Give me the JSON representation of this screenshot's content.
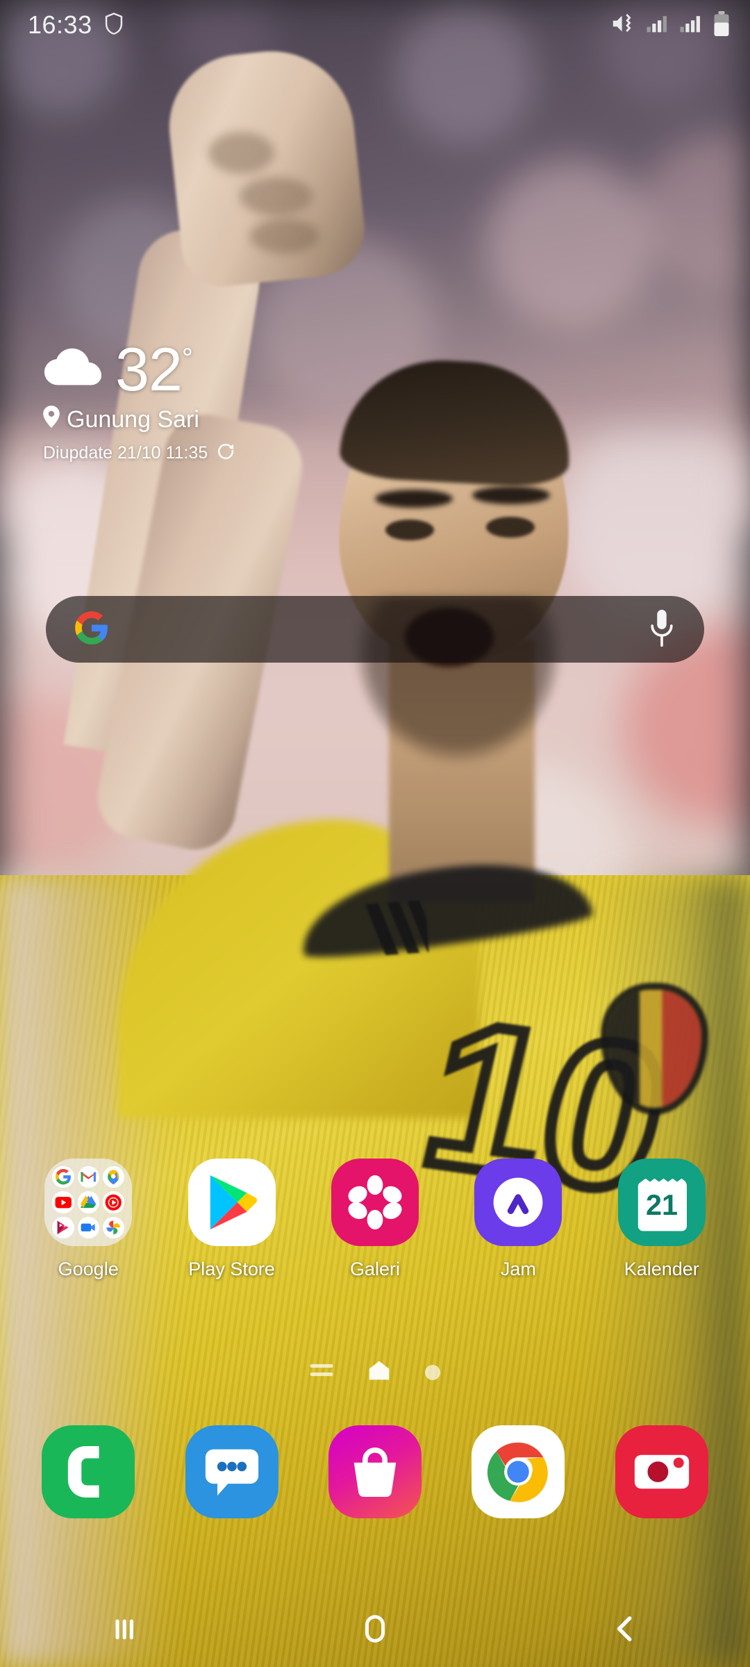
{
  "status_bar": {
    "time": "16:33",
    "icons": [
      "shield-icon",
      "sound-mute-vibrate-icon",
      "signal-sim1-icon",
      "signal-sim2-icon",
      "battery-icon"
    ],
    "battery_level_percent": 60
  },
  "weather_widget": {
    "condition_icon": "cloud-icon",
    "temperature": "32",
    "degree_symbol": "°",
    "location": "Gunung Sari",
    "location_icon": "location-pin-icon",
    "updated_text": "Diupdate 21/10 11:35",
    "refresh_icon": "refresh-icon"
  },
  "search_bar": {
    "leading_icon": "google-g-icon",
    "trailing_icon": "microphone-icon",
    "query": ""
  },
  "app_grid": [
    {
      "label": "Google",
      "type": "folder",
      "bg": "#f0f0f0",
      "apps": [
        "google-icon",
        "gmail-icon",
        "maps-icon",
        "youtube-icon",
        "drive-icon",
        "youtube-music-icon",
        "play-movies-icon",
        "meet-icon",
        "photos-icon"
      ]
    },
    {
      "label": "Play Store",
      "type": "app",
      "icon": "play-store-icon",
      "bg": "#ffffff"
    },
    {
      "label": "Galeri",
      "type": "app",
      "icon": "gallery-flower-icon",
      "bg": "#e3146a"
    },
    {
      "label": "Jam",
      "type": "app",
      "icon": "clock-icon",
      "bg": "#6b3ce9"
    },
    {
      "label": "Kalender",
      "type": "app",
      "icon": "calendar-icon",
      "bg": "#12a182",
      "date": "21"
    }
  ],
  "page_indicator": {
    "items": [
      "menu-lines-icon",
      "home-page-icon",
      "page-dot"
    ],
    "active_index": 1,
    "total_pages": 3
  },
  "dock": [
    {
      "label": "Phone",
      "icon": "phone-icon",
      "bg": "#1ab759"
    },
    {
      "label": "Messages",
      "icon": "messages-icon",
      "bg": "#2b93e0"
    },
    {
      "label": "Galaxy Store",
      "icon": "shopping-bag-icon",
      "bg": "#e3179d"
    },
    {
      "label": "Chrome",
      "icon": "chrome-icon",
      "bg": "#ffffff"
    },
    {
      "label": "Camera",
      "icon": "camera-icon",
      "bg": "#e8213f"
    }
  ],
  "nav_bar": {
    "recents_label": "Recents",
    "home_label": "Home",
    "back_label": "Back",
    "icons": [
      "recents-icon",
      "home-icon",
      "back-icon"
    ]
  },
  "wallpaper": {
    "description": "Footballer in yellow jersey number 10 raising fist, blurred stadium crowd",
    "jersey_number": "10",
    "jersey_color": "#e8ce2c"
  },
  "theme": {
    "text_color": "#ffffff",
    "search_bar_bg": "rgba(18,14,14,0.64)"
  }
}
